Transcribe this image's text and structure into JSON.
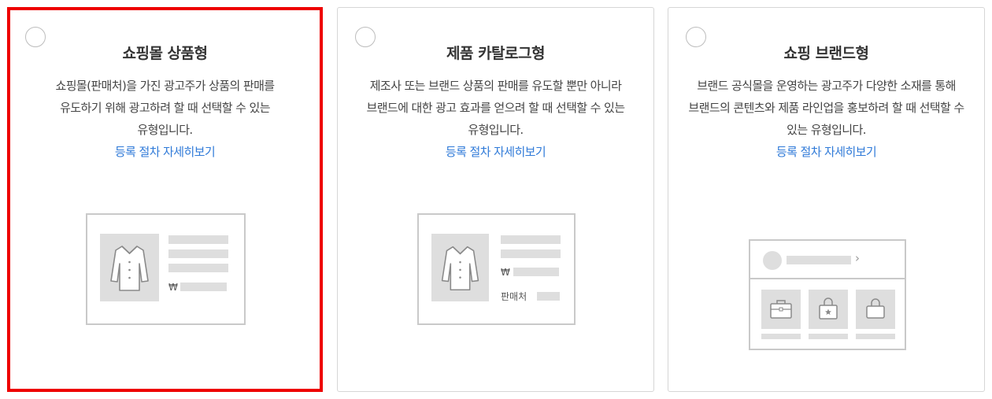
{
  "cards": [
    {
      "title": "쇼핑몰 상품형",
      "description": "쇼핑몰(판매처)을 가진 광고주가 상품의 판매를 유도하기 위해 광고하려 할 때 선택할 수 있는 유형입니다.",
      "link": "등록 절차 자세히보기",
      "selected": true,
      "illustration": {
        "price_symbol": "₩"
      }
    },
    {
      "title": "제품 카탈로그형",
      "description": "제조사 또는 브랜드 상품의 판매를 유도할 뿐만 아니라 브랜드에 대한 광고 효과를 얻으려 할 때 선택할 수 있는 유형입니다.",
      "link": "등록 절차 자세히보기",
      "selected": false,
      "illustration": {
        "price_symbol": "₩",
        "seller_label": "판매처"
      }
    },
    {
      "title": "쇼핑 브랜드형",
      "description": "브랜드 공식몰을 운영하는 광고주가 다양한 소재를 통해 브랜드의 콘텐츠와 제품 라인업을 홍보하려 할 때 선택할 수 있는 유형입니다.",
      "link": "등록 절차 자세히보기",
      "selected": false,
      "illustration": {
        "chevron": "›"
      }
    }
  ],
  "colors": {
    "selected_border": "#ee0000",
    "link": "#2f7ad8",
    "card_border": "#d6d6d6"
  },
  "icons": [
    "shirt-icon",
    "briefcase-icon",
    "shopping-bag-star-icon",
    "shopping-bag-icon",
    "chevron-right-icon"
  ]
}
